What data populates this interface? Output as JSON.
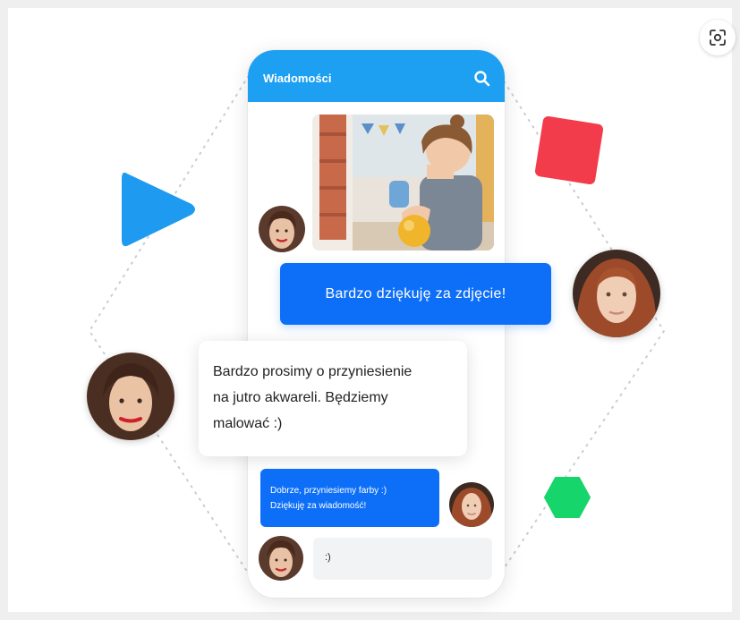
{
  "lens_button": {
    "icon": "lens-scan-icon"
  },
  "phone": {
    "header_title": "Wiadomości",
    "header_color": "#1d9ff2",
    "search_icon": "search-icon"
  },
  "messages": [
    {
      "type": "photo",
      "sender": "teacher",
      "content": "photo of a child holding an orange cup"
    },
    {
      "type": "outgoing",
      "text": "Bardzo dziękuję za zdjęcie!",
      "avatar": "parent-red-hair"
    },
    {
      "type": "incoming",
      "text": "Bardzo prosimy o przyniesienie\nna jutro akwareli. Będziemy\nmalować :)",
      "avatar": "teacher"
    },
    {
      "type": "outgoing",
      "text": "Dobrze, przyniesiemy farby :)\nDziękuję za wiadomość!",
      "avatar": "parent-red-hair"
    },
    {
      "type": "incoming",
      "text": ":)",
      "avatar": "teacher"
    }
  ],
  "colors": {
    "accent_blue": "#0d6ff7",
    "light_blue": "#1d9ff2",
    "play_blue": "#1e9bf0",
    "square_red": "#f33c4b",
    "hexagon_green": "#16d56a",
    "dotted_ring": "#c9ccd2"
  },
  "decorations": [
    "play-triangle",
    "red-square",
    "green-hexagon",
    "dotted-hexagon-ring"
  ]
}
